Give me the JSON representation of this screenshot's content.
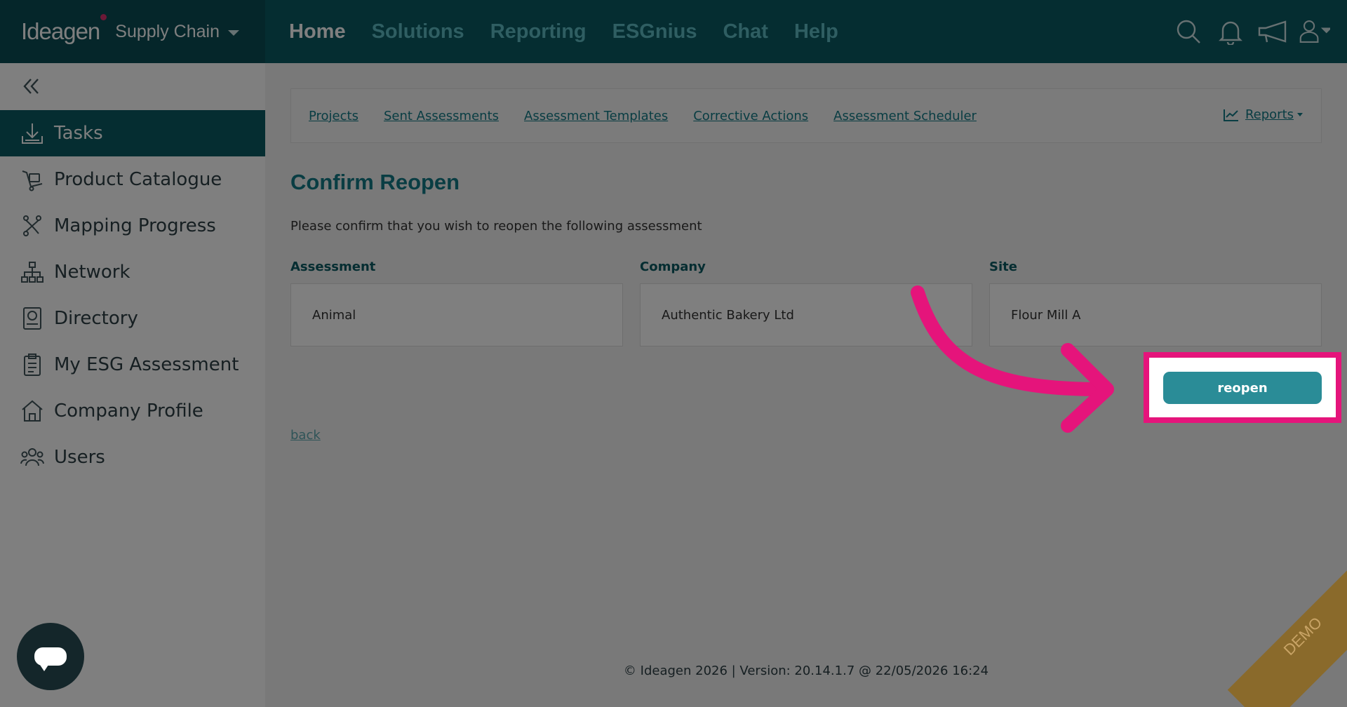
{
  "header": {
    "logo": "Ideagen",
    "product": "Supply Chain",
    "nav": [
      "Home",
      "Solutions",
      "Reporting",
      "ESGnius",
      "Chat",
      "Help"
    ],
    "active_nav": "Home"
  },
  "sidebar": {
    "items": [
      {
        "label": "Tasks",
        "icon": "download-tray-icon"
      },
      {
        "label": "Product Catalogue",
        "icon": "cart-icon"
      },
      {
        "label": "Mapping Progress",
        "icon": "route-icon"
      },
      {
        "label": "Network",
        "icon": "network-icon"
      },
      {
        "label": "Directory",
        "icon": "directory-icon"
      },
      {
        "label": "My ESG Assessment",
        "icon": "clipboard-icon"
      },
      {
        "label": "Company Profile",
        "icon": "building-icon"
      },
      {
        "label": "Users",
        "icon": "users-icon"
      }
    ],
    "active": "Tasks"
  },
  "subnav": {
    "links": [
      "Projects",
      "Sent Assessments",
      "Assessment Templates",
      "Corrective Actions",
      "Assessment Scheduler"
    ],
    "reports": "Reports"
  },
  "main": {
    "title": "Confirm Reopen",
    "description": "Please confirm that you wish to reopen the following assessment",
    "fields": [
      {
        "label": "Assessment",
        "value": "Animal"
      },
      {
        "label": "Company",
        "value": "Authentic Bakery Ltd"
      },
      {
        "label": "Site",
        "value": "Flour Mill A"
      }
    ],
    "reopen_label": "reopen",
    "back_label": "back"
  },
  "footer": "© Ideagen 2026 | Version: 20.14.1.7 @ 22/05/2026 16:24",
  "ribbon": "DEMO",
  "colors": {
    "brand_dark": "#0b5a63",
    "accent_teal": "#2a8c97",
    "highlight_pink": "#e5147b"
  }
}
